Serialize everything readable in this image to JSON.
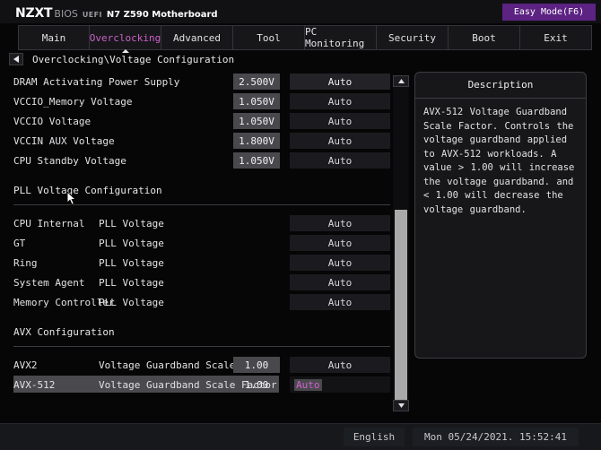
{
  "header": {
    "brand_name": "NZXT",
    "brand_bios": "BIOS",
    "brand_uefi": "UEFI",
    "brand_board": "N7 Z590 Motherboard",
    "easy_mode_label": "Easy Mode(F6)",
    "accent_color": "#5c2382",
    "active_tab_color": "#cc60c8"
  },
  "tabs": [
    {
      "label": "Main",
      "active": false
    },
    {
      "label": "Overclocking",
      "active": true
    },
    {
      "label": "Advanced",
      "active": false
    },
    {
      "label": "Tool",
      "active": false
    },
    {
      "label": "PC Monitoring",
      "active": false
    },
    {
      "label": "Security",
      "active": false
    },
    {
      "label": "Boot",
      "active": false
    },
    {
      "label": "Exit",
      "active": false
    }
  ],
  "breadcrumb": {
    "back_icon": "back-arrow-icon",
    "path": "Overclocking\\Voltage Configuration"
  },
  "settings": {
    "voltage_rows": [
      {
        "label": "DRAM Activating Power Supply",
        "value": "2.500V",
        "option": "Auto"
      },
      {
        "label": "VCCIO_Memory Voltage",
        "value": "1.050V",
        "option": "Auto"
      },
      {
        "label": "VCCIO Voltage",
        "value": "1.050V",
        "option": "Auto"
      },
      {
        "label": "VCCIN AUX Voltage",
        "value": "1.800V",
        "option": "Auto"
      },
      {
        "label": "CPU Standby Voltage",
        "value": "1.050V",
        "option": "Auto"
      }
    ],
    "pll_section_title": "PLL Voltage Configuration",
    "pll_rows": [
      {
        "label": "CPU Internal",
        "label2": "PLL Voltage",
        "option": "Auto"
      },
      {
        "label": "GT",
        "label2": "PLL Voltage",
        "option": "Auto"
      },
      {
        "label": "Ring",
        "label2": "PLL Voltage",
        "option": "Auto"
      },
      {
        "label": "System Agent",
        "label2": "PLL Voltage",
        "option": "Auto"
      },
      {
        "label": "Memory Controller",
        "label2": "PLL Voltage",
        "option": "Auto"
      }
    ],
    "avx_section_title": "AVX Configuration",
    "avx_rows": [
      {
        "label": "AVX2",
        "label2": "Voltage Guardband Scale Factor",
        "value": "1.00",
        "option": "Auto",
        "selected": false
      },
      {
        "label": "AVX-512",
        "label2": "Voltage Guardband Scale Factor",
        "value": "1.00",
        "option": "Auto",
        "selected": true
      }
    ]
  },
  "scrollbar": {
    "up_icon": "scroll-up-arrow-icon",
    "down_icon": "scroll-down-arrow-icon"
  },
  "description": {
    "title": "Description",
    "body": "AVX-512 Voltage Guardband Scale Factor. Controls the voltage guardband applied to AVX-512 workloads. A value > 1.00 will increase the voltage guardband. and < 1.00 will decrease the voltage guardband."
  },
  "footer": {
    "language": "English",
    "datetime": "Mon 05/24/2021. 15:52:41"
  }
}
